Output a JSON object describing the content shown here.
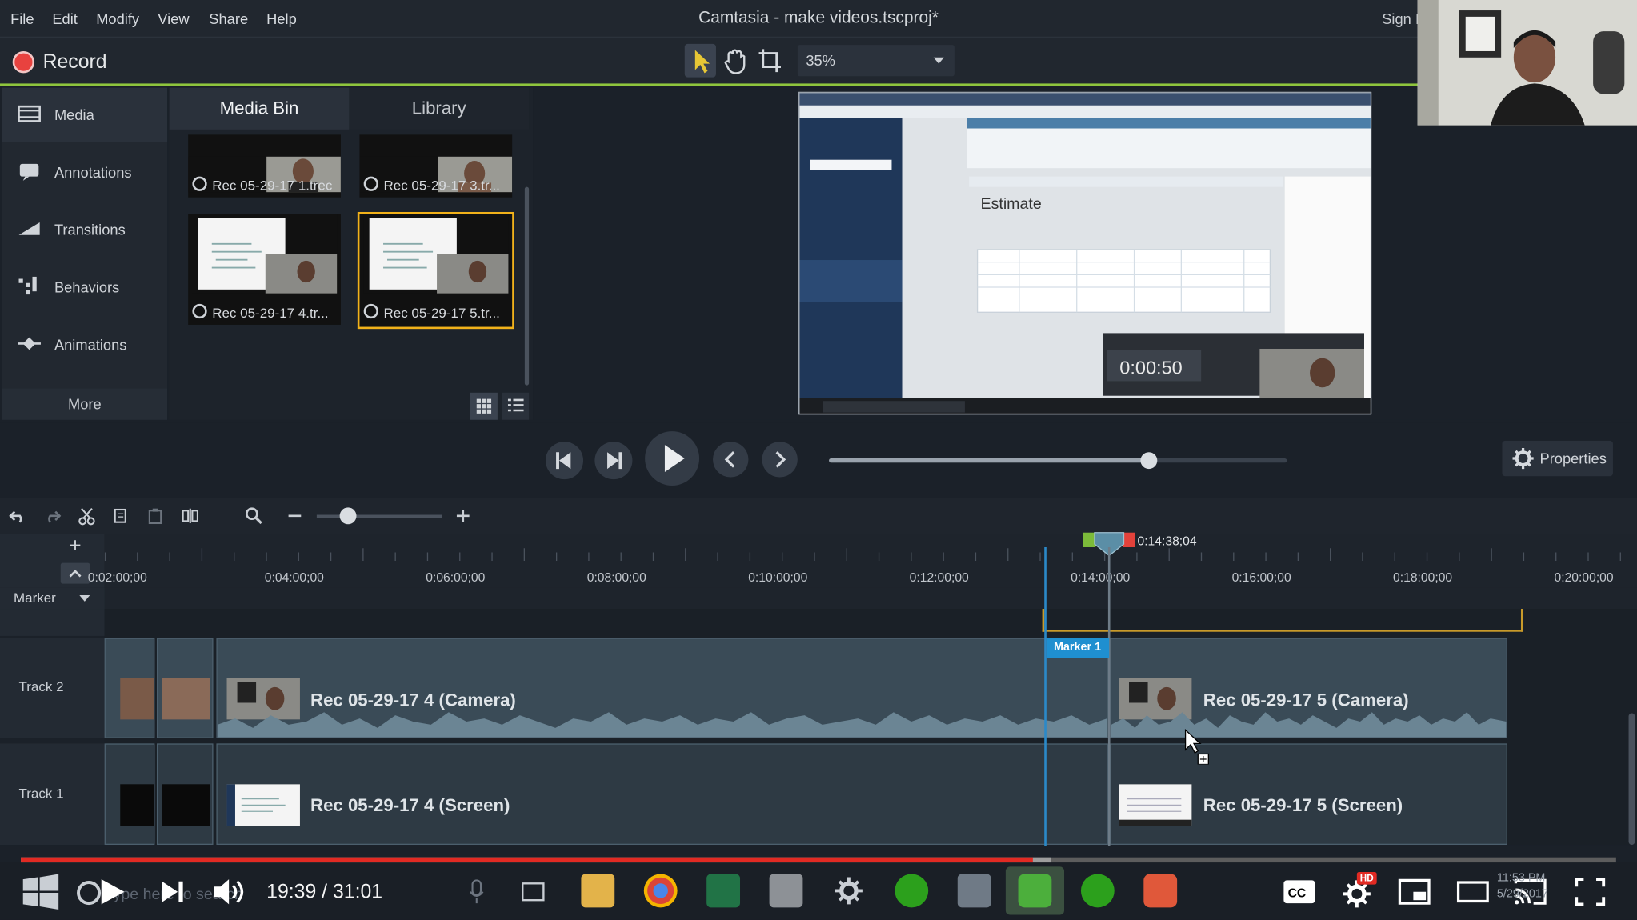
{
  "window": {
    "title": "Camtasia - make videos.tscproj*"
  },
  "menu": [
    "File",
    "Edit",
    "Modify",
    "View",
    "Share",
    "Help"
  ],
  "sign_in": "Sign I",
  "toolbar": {
    "record_label": "Record",
    "zoom": "35%"
  },
  "sidebar": {
    "items": [
      {
        "label": "Media",
        "icon": "film-icon"
      },
      {
        "label": "Annotations",
        "icon": "annotation-icon"
      },
      {
        "label": "Transitions",
        "icon": "transition-icon"
      },
      {
        "label": "Behaviors",
        "icon": "behavior-icon"
      },
      {
        "label": "Animations",
        "icon": "animation-icon"
      }
    ],
    "more_label": "More"
  },
  "bin": {
    "tabs": [
      "Media Bin",
      "Library"
    ],
    "items": [
      {
        "label": "Rec 05-29-17 1.trec"
      },
      {
        "label": "Rec 05-29-17 3.tr..."
      },
      {
        "label": "Rec 05-29-17 4.tr..."
      },
      {
        "label": "Rec 05-29-17 5.tr...",
        "selected": true
      }
    ]
  },
  "canvas": {
    "heading": "Estimate",
    "recorder_time": "0:00:50"
  },
  "player": {
    "properties_label": "Properties",
    "progress": 0.7
  },
  "timeline": {
    "current_time": "0:14:38;04",
    "ticks": [
      "0:02:00;00",
      "0:04:00;00",
      "0:06:00;00",
      "0:08:00;00",
      "0:10:00;00",
      "0:12:00;00",
      "0:14:00;00",
      "0:16:00;00",
      "0:18:00;00",
      "0:20:00;00"
    ],
    "marker_label": "Marker",
    "marker_flag": "Marker 1",
    "tracks": [
      {
        "name": "Track 2",
        "clips": [
          "Rec 05-29-17 4 (Camera)",
          "Rec 05-29-17 5 (Camera)"
        ]
      },
      {
        "name": "Track 1",
        "clips": [
          "Rec 05-29-17 4 (Screen)",
          "Rec 05-29-17 5 (Screen)"
        ]
      }
    ]
  },
  "youtube": {
    "time": "19:39 / 31:01",
    "played": 0.6343,
    "buffered": 0.6455,
    "search_placeholder": "Type here to search",
    "clock": "11:53 PM",
    "date": "5/29/2017",
    "hd_badge": "HD"
  },
  "colors": {
    "accent_green": "#8fc53d",
    "record_red": "#e8423f",
    "select_orange": "#f2b21a",
    "yt_red": "#e22a23",
    "marker_blue": "#1f8fd0"
  }
}
